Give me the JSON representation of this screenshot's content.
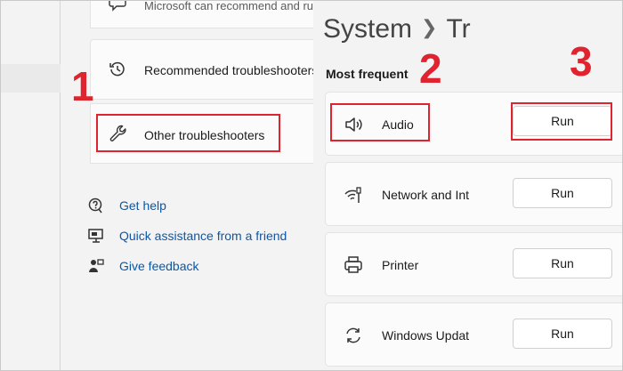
{
  "left": {
    "top_card_text": "Microsoft can recommend and run",
    "recommended_label": "Recommended troubleshooters",
    "other_label": "Other troubleshooters",
    "links": [
      {
        "label": "Get help",
        "icon": "help-icon"
      },
      {
        "label": "Quick assistance from a friend",
        "icon": "remote-desktop-icon"
      },
      {
        "label": "Give feedback",
        "icon": "feedback-icon"
      }
    ]
  },
  "right": {
    "breadcrumb_root": "System",
    "breadcrumb_next": "Tr",
    "section_title": "Most frequent",
    "items": [
      {
        "label": "Audio",
        "icon": "speaker-icon",
        "button": "Run"
      },
      {
        "label": "Network and Internet",
        "icon": "network-icon",
        "button": "Run"
      },
      {
        "label": "Printer",
        "icon": "printer-icon",
        "button": "Run"
      },
      {
        "label": "Windows Update",
        "icon": "refresh-icon",
        "button": "Run"
      }
    ]
  },
  "annotations": {
    "step1": "1",
    "step2": "2",
    "step3": "3",
    "color": "#e0242f"
  },
  "colors": {
    "link": "#0c57a6",
    "card": "#fbfbfb",
    "background": "#f3f3f3"
  }
}
